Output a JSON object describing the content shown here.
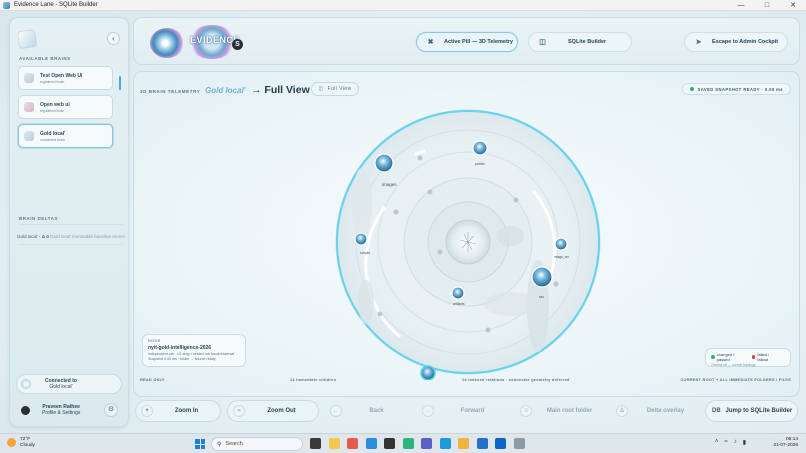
{
  "window": {
    "title": "Evidence Lane - SQLite Builder"
  },
  "sidebar": {
    "available_brains_label": "AVAILABLE BRAINS",
    "brains": [
      {
        "name": "Test Open Web Ui",
        "status": "registered brain"
      },
      {
        "name": "Open web ui",
        "status": "registered brain"
      },
      {
        "name": "Gold local'",
        "status": "connected brain"
      }
    ],
    "brain_deltas_label": "BRAIN DELTAS",
    "delta": {
      "name": "Gold local'",
      "arrow": "· Δ 0",
      "detail": "Gold local'  immutable baseline recent"
    },
    "connected": {
      "line1": "Connected to",
      "line2": "Gold local'"
    },
    "profile": {
      "name": "Praveen Rathee",
      "subtitle": "Profile & Settings"
    }
  },
  "header": {
    "brand_word": "EVIDENCE",
    "brand_mark": "S",
    "telemetry_button": "Active Pill — 3D Telemetry",
    "sqlite_button": "SQLite Builder",
    "escape_button": "Escape to Admin Cockpit"
  },
  "main": {
    "telemetry_label": "3D BRAIN TELEMETRY",
    "brain_name": "Gold local'",
    "view_title": "→ Full View",
    "full_view_button": "Full View",
    "snapshot_status": "SAVED SNAPSHOT READY · 0.00 ms",
    "nodes": [
      {
        "label": "images"
      },
      {
        "label": "public"
      },
      {
        "label": "scripts"
      },
      {
        "label": "image_src"
      },
      {
        "label": "src"
      },
      {
        "label": "artifacts"
      }
    ],
    "node_card": {
      "kind": "NODE",
      "name": "nyit-gold-intelligence-2026",
      "detail1": "independent orb · r/2 drag • nested orb focus traversal",
      "detail2": "Snapshot 0.00 ms · folder → source ready"
    },
    "legend": {
      "changed_label": "changed / passed",
      "failed_label": "failed / fallout",
      "note": "Overlay off — normal topology",
      "changed_color": "#2db47c",
      "failed_color": "#d8453a"
    },
    "footer": {
      "mode": "READ ONLY",
      "children": "14 immediate children",
      "relations": "14 indexed relations · connector geometry deferred",
      "scope": "CURRENT ROOT + ALL IMMEDIATE FOLDERS / FILES"
    }
  },
  "toolbar": {
    "zoom_in": "Zoom In",
    "zoom_out": "Zoom Out",
    "back": "Back",
    "forward": "Forward",
    "main_root": "Main root folder",
    "delta_overlay": "Delta overlay",
    "jump_prefix": "DB",
    "jump": "Jump to SQLite Builder"
  },
  "taskbar": {
    "temperature": "72°F",
    "condition": "Cloudy",
    "search_placeholder": "Search",
    "time": "06:14",
    "date": "21-07-2026",
    "tray_icons": [
      "file-explorer-icon",
      "folder-icon",
      "chrome-icon",
      "vscode-icon",
      "terminal-icon",
      "whatsapp-icon",
      "teams-icon",
      "edge-icon",
      "store-icon",
      "mail-icon",
      "linkedin-icon",
      "app-icon"
    ]
  }
}
